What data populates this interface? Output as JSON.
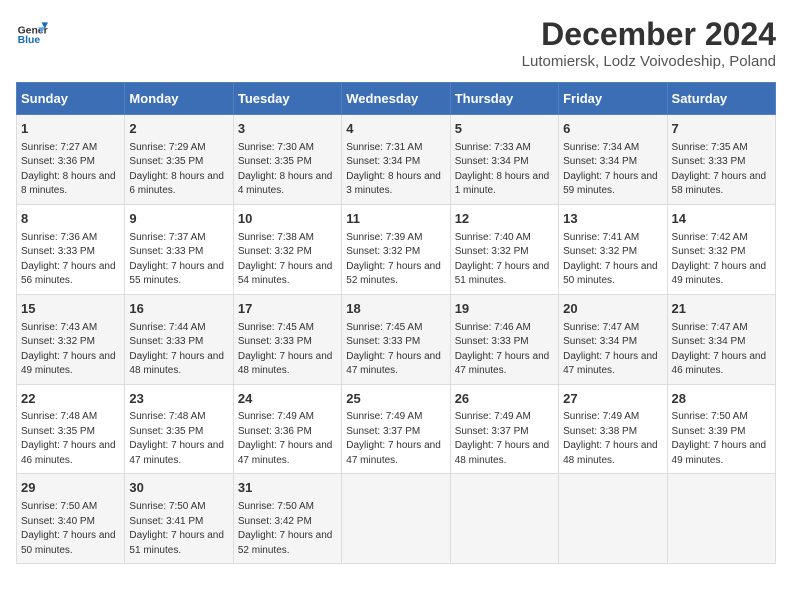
{
  "header": {
    "logo_general": "General",
    "logo_blue": "Blue",
    "title": "December 2024",
    "subtitle": "Lutomiersk, Lodz Voivodeship, Poland"
  },
  "days_of_week": [
    "Sunday",
    "Monday",
    "Tuesday",
    "Wednesday",
    "Thursday",
    "Friday",
    "Saturday"
  ],
  "weeks": [
    [
      {
        "day": "1",
        "sunrise": "Sunrise: 7:27 AM",
        "sunset": "Sunset: 3:36 PM",
        "daylight": "Daylight: 8 hours and 8 minutes."
      },
      {
        "day": "2",
        "sunrise": "Sunrise: 7:29 AM",
        "sunset": "Sunset: 3:35 PM",
        "daylight": "Daylight: 8 hours and 6 minutes."
      },
      {
        "day": "3",
        "sunrise": "Sunrise: 7:30 AM",
        "sunset": "Sunset: 3:35 PM",
        "daylight": "Daylight: 8 hours and 4 minutes."
      },
      {
        "day": "4",
        "sunrise": "Sunrise: 7:31 AM",
        "sunset": "Sunset: 3:34 PM",
        "daylight": "Daylight: 8 hours and 3 minutes."
      },
      {
        "day": "5",
        "sunrise": "Sunrise: 7:33 AM",
        "sunset": "Sunset: 3:34 PM",
        "daylight": "Daylight: 8 hours and 1 minute."
      },
      {
        "day": "6",
        "sunrise": "Sunrise: 7:34 AM",
        "sunset": "Sunset: 3:34 PM",
        "daylight": "Daylight: 7 hours and 59 minutes."
      },
      {
        "day": "7",
        "sunrise": "Sunrise: 7:35 AM",
        "sunset": "Sunset: 3:33 PM",
        "daylight": "Daylight: 7 hours and 58 minutes."
      }
    ],
    [
      {
        "day": "8",
        "sunrise": "Sunrise: 7:36 AM",
        "sunset": "Sunset: 3:33 PM",
        "daylight": "Daylight: 7 hours and 56 minutes."
      },
      {
        "day": "9",
        "sunrise": "Sunrise: 7:37 AM",
        "sunset": "Sunset: 3:33 PM",
        "daylight": "Daylight: 7 hours and 55 minutes."
      },
      {
        "day": "10",
        "sunrise": "Sunrise: 7:38 AM",
        "sunset": "Sunset: 3:32 PM",
        "daylight": "Daylight: 7 hours and 54 minutes."
      },
      {
        "day": "11",
        "sunrise": "Sunrise: 7:39 AM",
        "sunset": "Sunset: 3:32 PM",
        "daylight": "Daylight: 7 hours and 52 minutes."
      },
      {
        "day": "12",
        "sunrise": "Sunrise: 7:40 AM",
        "sunset": "Sunset: 3:32 PM",
        "daylight": "Daylight: 7 hours and 51 minutes."
      },
      {
        "day": "13",
        "sunrise": "Sunrise: 7:41 AM",
        "sunset": "Sunset: 3:32 PM",
        "daylight": "Daylight: 7 hours and 50 minutes."
      },
      {
        "day": "14",
        "sunrise": "Sunrise: 7:42 AM",
        "sunset": "Sunset: 3:32 PM",
        "daylight": "Daylight: 7 hours and 49 minutes."
      }
    ],
    [
      {
        "day": "15",
        "sunrise": "Sunrise: 7:43 AM",
        "sunset": "Sunset: 3:32 PM",
        "daylight": "Daylight: 7 hours and 49 minutes."
      },
      {
        "day": "16",
        "sunrise": "Sunrise: 7:44 AM",
        "sunset": "Sunset: 3:33 PM",
        "daylight": "Daylight: 7 hours and 48 minutes."
      },
      {
        "day": "17",
        "sunrise": "Sunrise: 7:45 AM",
        "sunset": "Sunset: 3:33 PM",
        "daylight": "Daylight: 7 hours and 48 minutes."
      },
      {
        "day": "18",
        "sunrise": "Sunrise: 7:45 AM",
        "sunset": "Sunset: 3:33 PM",
        "daylight": "Daylight: 7 hours and 47 minutes."
      },
      {
        "day": "19",
        "sunrise": "Sunrise: 7:46 AM",
        "sunset": "Sunset: 3:33 PM",
        "daylight": "Daylight: 7 hours and 47 minutes."
      },
      {
        "day": "20",
        "sunrise": "Sunrise: 7:47 AM",
        "sunset": "Sunset: 3:34 PM",
        "daylight": "Daylight: 7 hours and 47 minutes."
      },
      {
        "day": "21",
        "sunrise": "Sunrise: 7:47 AM",
        "sunset": "Sunset: 3:34 PM",
        "daylight": "Daylight: 7 hours and 46 minutes."
      }
    ],
    [
      {
        "day": "22",
        "sunrise": "Sunrise: 7:48 AM",
        "sunset": "Sunset: 3:35 PM",
        "daylight": "Daylight: 7 hours and 46 minutes."
      },
      {
        "day": "23",
        "sunrise": "Sunrise: 7:48 AM",
        "sunset": "Sunset: 3:35 PM",
        "daylight": "Daylight: 7 hours and 47 minutes."
      },
      {
        "day": "24",
        "sunrise": "Sunrise: 7:49 AM",
        "sunset": "Sunset: 3:36 PM",
        "daylight": "Daylight: 7 hours and 47 minutes."
      },
      {
        "day": "25",
        "sunrise": "Sunrise: 7:49 AM",
        "sunset": "Sunset: 3:37 PM",
        "daylight": "Daylight: 7 hours and 47 minutes."
      },
      {
        "day": "26",
        "sunrise": "Sunrise: 7:49 AM",
        "sunset": "Sunset: 3:37 PM",
        "daylight": "Daylight: 7 hours and 48 minutes."
      },
      {
        "day": "27",
        "sunrise": "Sunrise: 7:49 AM",
        "sunset": "Sunset: 3:38 PM",
        "daylight": "Daylight: 7 hours and 48 minutes."
      },
      {
        "day": "28",
        "sunrise": "Sunrise: 7:50 AM",
        "sunset": "Sunset: 3:39 PM",
        "daylight": "Daylight: 7 hours and 49 minutes."
      }
    ],
    [
      {
        "day": "29",
        "sunrise": "Sunrise: 7:50 AM",
        "sunset": "Sunset: 3:40 PM",
        "daylight": "Daylight: 7 hours and 50 minutes."
      },
      {
        "day": "30",
        "sunrise": "Sunrise: 7:50 AM",
        "sunset": "Sunset: 3:41 PM",
        "daylight": "Daylight: 7 hours and 51 minutes."
      },
      {
        "day": "31",
        "sunrise": "Sunrise: 7:50 AM",
        "sunset": "Sunset: 3:42 PM",
        "daylight": "Daylight: 7 hours and 52 minutes."
      },
      null,
      null,
      null,
      null
    ]
  ]
}
